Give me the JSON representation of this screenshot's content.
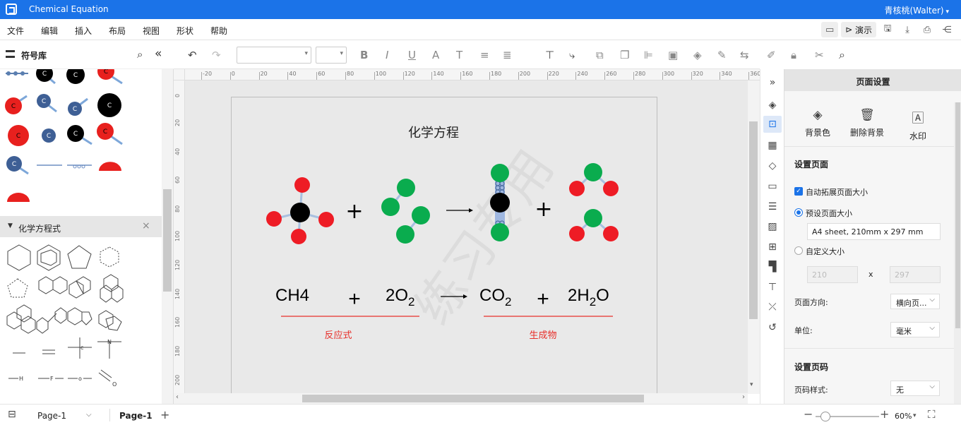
{
  "app": {
    "title": "Chemical Equation",
    "user": "青核桃(Walter)"
  },
  "menu": [
    "文件",
    "编辑",
    "插入",
    "布局",
    "视图",
    "形状",
    "帮助"
  ],
  "toolbar_right": {
    "present_label": "演示"
  },
  "left": {
    "title": "符号库",
    "section_title": "化学方程式"
  },
  "ruler_h": [
    "-20",
    "0",
    "20",
    "40",
    "60",
    "80",
    "100",
    "120",
    "140",
    "160",
    "180",
    "200",
    "220",
    "240",
    "260",
    "280",
    "300",
    "320",
    "340",
    "360"
  ],
  "ruler_v": [
    "0",
    "20",
    "40",
    "60",
    "80",
    "100",
    "120",
    "140",
    "160",
    "180",
    "200"
  ],
  "canvas": {
    "title": "化学方程",
    "eq_left1": "CH4",
    "plus": "+",
    "eq_left2": "2O",
    "eq_left2_sub": "2",
    "eq_right1": "CO",
    "eq_right1_sub": "2",
    "eq_right2": "2H",
    "eq_right2_sub": "2",
    "eq_right2_end": "O",
    "label_reactant": "反应式",
    "label_product": "生成物",
    "accent_red": "#e8302b",
    "watermark": "练习专用"
  },
  "right": {
    "header": "页面设置",
    "bg_color": "背景色",
    "remove_bg": "删除背景",
    "watermark": "水印",
    "setup_page": "设置页面",
    "auto_expand": "自动拓展页面大小",
    "preset": "预设页面大小",
    "preset_value": "A4 sheet, 210mm x 297 mm",
    "custom": "自定义大小",
    "width": "210",
    "x": "x",
    "height": "297",
    "orientation_label": "页面方向:",
    "orientation_value": "横向页...",
    "unit_label": "单位:",
    "unit_value": "毫米",
    "page_number": "设置页码",
    "page_style_label": "页码样式:",
    "page_style_value": "无"
  },
  "status": {
    "page_selector": "Page-1",
    "page_tab": "Page-1",
    "zoom": "60%"
  }
}
